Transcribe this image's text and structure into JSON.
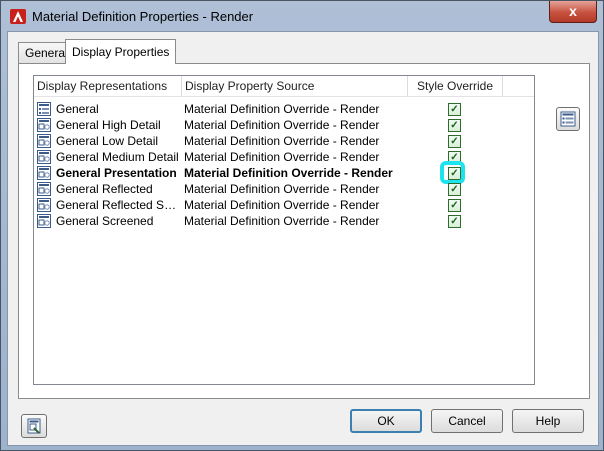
{
  "window": {
    "title": "Material Definition Properties - Render",
    "close_label": "x",
    "icon": "autocad-logo-icon"
  },
  "tabs": [
    {
      "label": "General",
      "selected": false
    },
    {
      "label": "Display Properties",
      "selected": true
    }
  ],
  "list": {
    "columns": [
      "Display Representations",
      "Display Property Source",
      "Style Override"
    ],
    "rows": [
      {
        "name": "General",
        "source": "Material Definition Override - Render",
        "override": true,
        "bold": false,
        "icon": "general-rep-icon"
      },
      {
        "name": "General High Detail",
        "source": "Material Definition Override - Render",
        "override": true,
        "bold": false,
        "icon": "display-rep-icon"
      },
      {
        "name": "General Low Detail",
        "source": "Material Definition Override - Render",
        "override": true,
        "bold": false,
        "icon": "display-rep-icon"
      },
      {
        "name": "General Medium Detail",
        "source": "Material Definition Override - Render",
        "override": true,
        "bold": false,
        "icon": "display-rep-icon"
      },
      {
        "name": "General Presentation",
        "source": "Material Definition Override - Render",
        "override": true,
        "bold": true,
        "icon": "display-rep-icon"
      },
      {
        "name": "General Reflected",
        "source": "Material Definition Override - Render",
        "override": true,
        "bold": false,
        "icon": "display-rep-icon"
      },
      {
        "name": "General Reflected Scre...",
        "source": "Material Definition Override - Render",
        "override": true,
        "bold": false,
        "icon": "display-rep-icon"
      },
      {
        "name": "General Screened",
        "source": "Material Definition Override - Render",
        "override": true,
        "bold": false,
        "icon": "display-rep-icon"
      }
    ]
  },
  "buttons": {
    "ok": "OK",
    "cancel": "Cancel",
    "help": "Help"
  },
  "icons": {
    "side": "edit-display-properties-icon",
    "corner": "open-style-manager-icon"
  },
  "colors": {
    "highlight": "#1ce3ee",
    "check": "#14621a",
    "ok_border": "#3c7fb1"
  }
}
